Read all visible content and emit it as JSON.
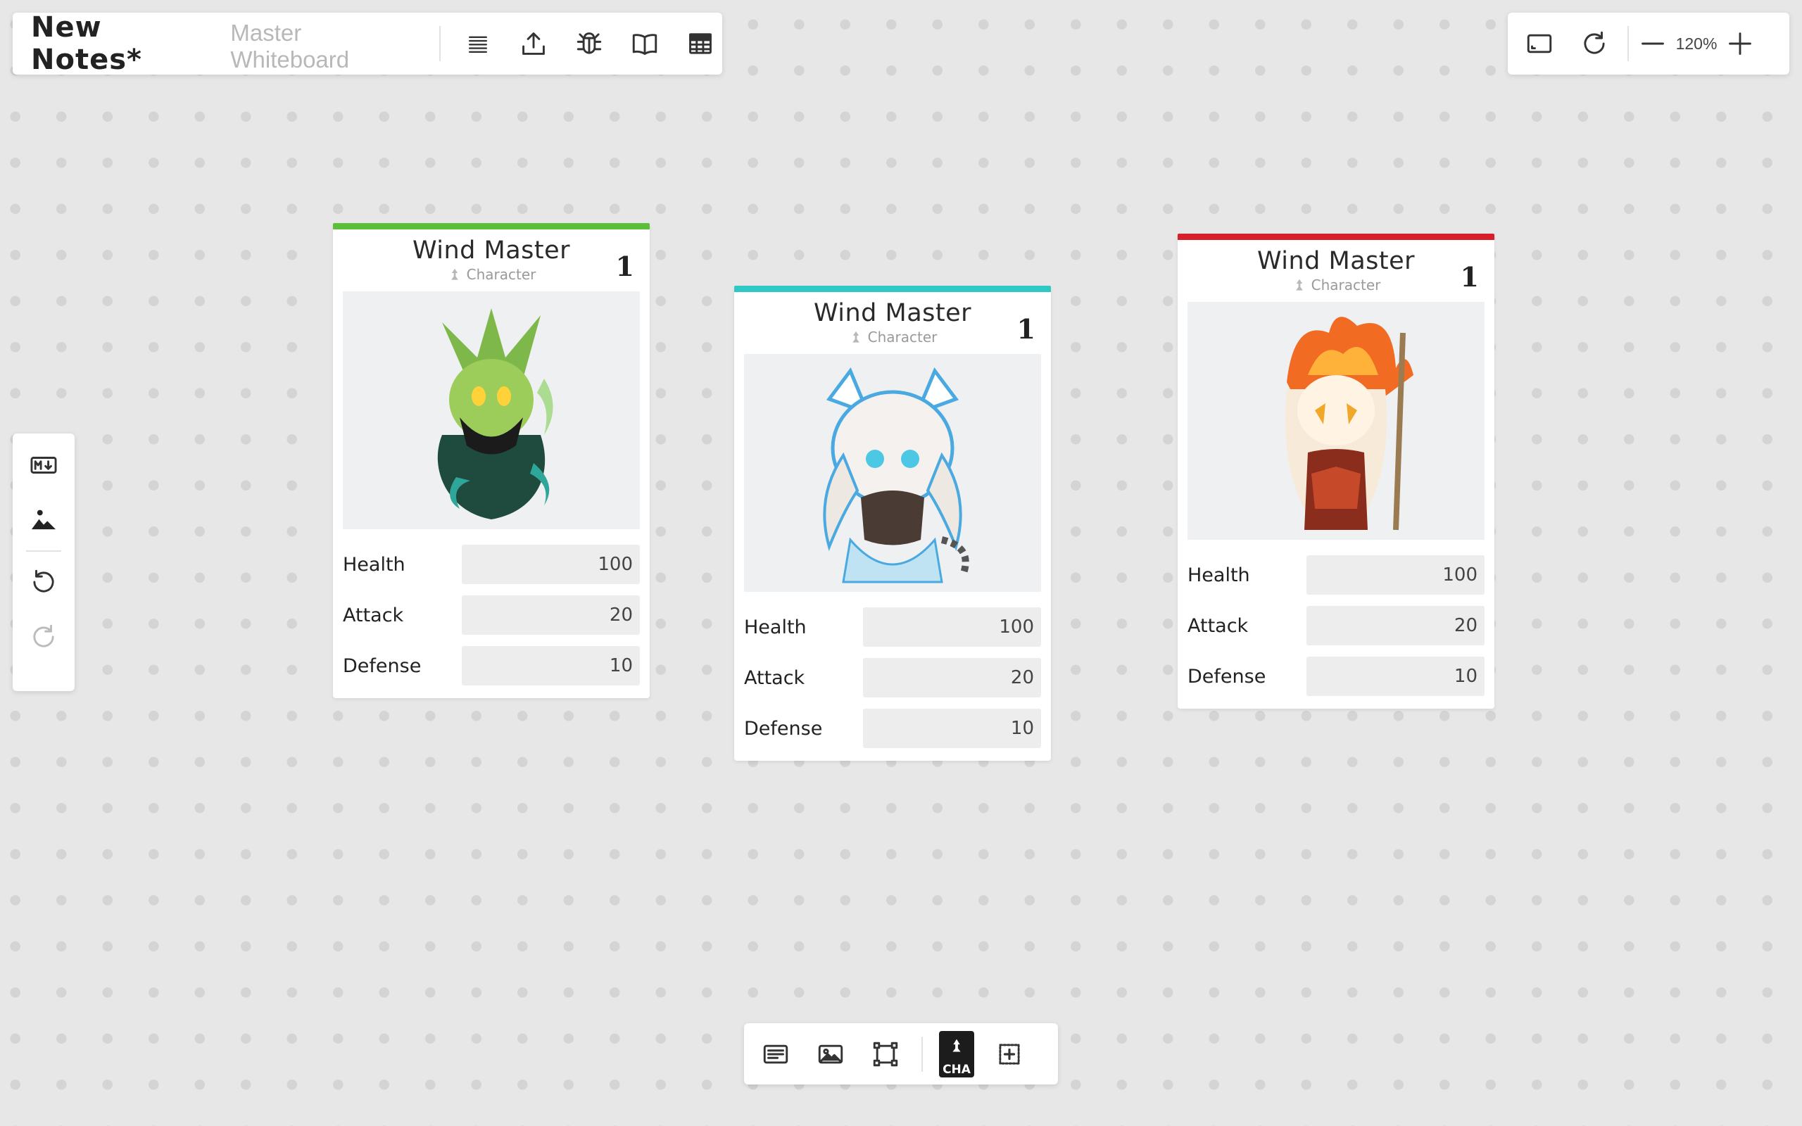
{
  "header": {
    "title": "New Notes*",
    "subtitle": "Master Whiteboard",
    "icons": [
      "menu-icon",
      "upload-icon",
      "bug-icon",
      "book-icon",
      "table-icon"
    ]
  },
  "zoom": {
    "label": "120%",
    "icons": [
      "fit-screen-icon",
      "refresh-icon",
      "zoom-out-icon",
      "zoom-in-icon"
    ]
  },
  "left_tools": {
    "icons": [
      "markdown-icon",
      "image-mountain-icon",
      "undo-icon",
      "redo-icon"
    ]
  },
  "bottom_tools": {
    "icons": [
      "text-note-icon",
      "image-icon",
      "frame-icon",
      "character-card-icon",
      "add-icon"
    ],
    "cha_label": "CHA"
  },
  "cards": [
    {
      "name": "Wind Master",
      "type": "Character",
      "level": "1",
      "accent": "#5cbf3a",
      "art": "green-dragon-character",
      "stats": [
        {
          "label": "Health",
          "value": "100"
        },
        {
          "label": "Attack",
          "value": "20"
        },
        {
          "label": "Defense",
          "value": "10"
        }
      ]
    },
    {
      "name": "Wind Master",
      "type": "Character",
      "level": "1",
      "accent": "#2ec9c5",
      "art": "white-tiger-character",
      "stats": [
        {
          "label": "Health",
          "value": "100"
        },
        {
          "label": "Attack",
          "value": "20"
        },
        {
          "label": "Defense",
          "value": "10"
        }
      ]
    },
    {
      "name": "Wind Master",
      "type": "Character",
      "level": "1",
      "accent": "#d81e2a",
      "art": "fire-mage-character",
      "stats": [
        {
          "label": "Health",
          "value": "100"
        },
        {
          "label": "Attack",
          "value": "20"
        },
        {
          "label": "Defense",
          "value": "10"
        }
      ]
    }
  ]
}
